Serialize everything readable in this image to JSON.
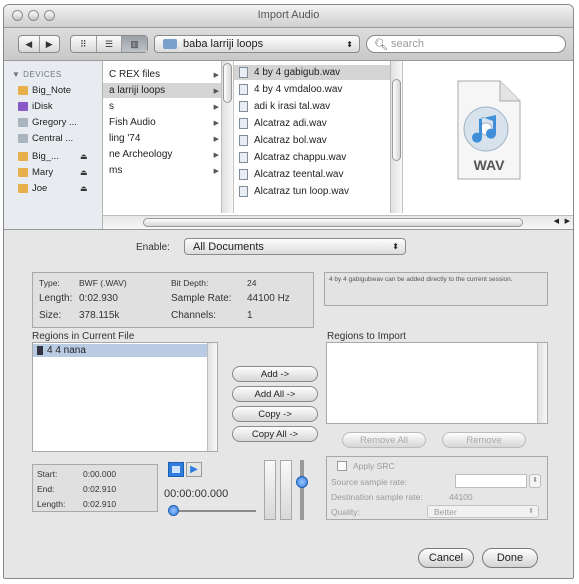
{
  "window": {
    "title": "Import Audio"
  },
  "toolbar": {
    "nav_back": "◀",
    "nav_forward": "▶",
    "view_icons": "⠿",
    "view_list": "☰",
    "view_columns": "▥",
    "location": "baba larriji loops",
    "search_placeholder": "search"
  },
  "sidebar": {
    "header": "DEVICES",
    "items": [
      {
        "label": "Big_Note",
        "color": "#e7b04a",
        "eject": false
      },
      {
        "label": "iDisk",
        "color": "#8a5ac8",
        "eject": false
      },
      {
        "label": "Gregory ...",
        "color": "#aab4be",
        "eject": false
      },
      {
        "label": "Central ...",
        "color": "#aab4be",
        "eject": false
      },
      {
        "label": "Big_...",
        "color": "#e7b04a",
        "eject": true
      },
      {
        "label": "Mary",
        "color": "#e7b04a",
        "eject": true
      },
      {
        "label": "Joe",
        "color": "#e7b04a",
        "eject": true
      }
    ],
    "eject_glyph": "⏏"
  },
  "folder_column": {
    "items": [
      {
        "label": "C REX files",
        "selected": false
      },
      {
        "label": "a larriji loops",
        "selected": true
      },
      {
        "label": "s",
        "selected": false
      },
      {
        "label": "Fish Audio",
        "selected": false
      },
      {
        "label": "ling '74",
        "selected": false
      },
      {
        "label": "ne Archeology",
        "selected": false
      },
      {
        "label": "ms",
        "selected": false
      }
    ]
  },
  "file_column": {
    "items": [
      {
        "label": "4 by 4 gabigub.wav",
        "selected": true
      },
      {
        "label": "4 by 4 vmdaloo.wav",
        "selected": false
      },
      {
        "label": "adi k irasi tal.wav",
        "selected": false
      },
      {
        "label": "Alcatraz adi.wav",
        "selected": false
      },
      {
        "label": "Alcatraz bol.wav",
        "selected": false
      },
      {
        "label": "Alcatraz chappu.wav",
        "selected": false
      },
      {
        "label": "Alcatraz teental.wav",
        "selected": false
      },
      {
        "label": "Alcatraz tun loop.wav",
        "selected": false
      }
    ]
  },
  "preview": {
    "badge": "WAV",
    "accent": "#3f8fd8"
  },
  "enable": {
    "label": "Enable:",
    "value": "All Documents"
  },
  "file_info": {
    "type_label": "Type:",
    "type_value": "BWF (.WAV)",
    "length_label": "Length:",
    "length_value": "0:02.930",
    "size_label": "Size:",
    "size_value": "378.115k",
    "bitdepth_label": "Bit Depth:",
    "bitdepth_value": "24",
    "samplerate_label": "Sample Rate:",
    "samplerate_value": "44100 Hz",
    "channels_label": "Channels:",
    "channels_value": "1"
  },
  "message": "4 by 4 gabigubwav can be added directly to the current session.",
  "regions_current": {
    "label": "Regions in Current File",
    "items": [
      "4 4 nana"
    ]
  },
  "regions_import": {
    "label": "Regions to Import"
  },
  "buttons": {
    "add": "Add ->",
    "add_all": "Add All ->",
    "copy": "Copy ->",
    "copy_all": "Copy All ->",
    "remove_all": "Remove All",
    "remove": "Remove",
    "cancel": "Cancel",
    "done": "Done"
  },
  "region_info": {
    "start_label": "Start:",
    "start_value": "0:00.000",
    "end_label": "End:",
    "end_value": "0:02.910",
    "length_label": "Length:",
    "length_value": "0:02.910"
  },
  "transport": {
    "time": "00:00:00.000"
  },
  "src": {
    "apply_label": "Apply SRC",
    "source_label": "Source sample rate:",
    "dest_label": "Destination sample rate:",
    "dest_value": "44100",
    "quality_label": "Quality:",
    "quality_value": "Better"
  }
}
